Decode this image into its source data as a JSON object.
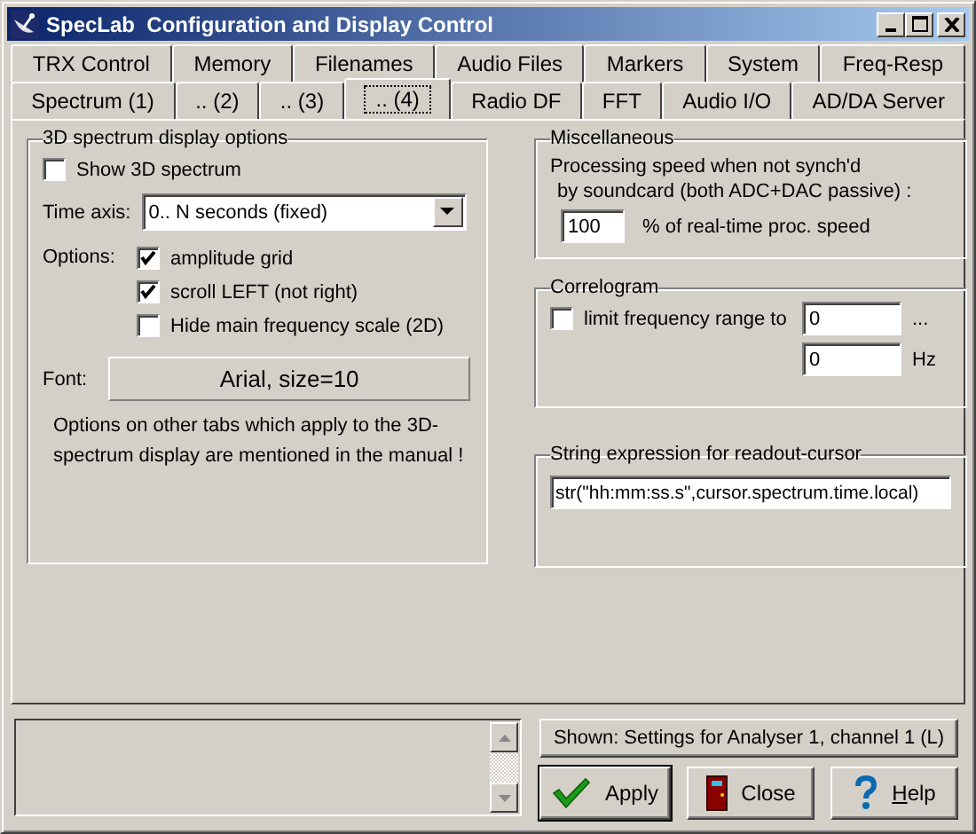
{
  "window": {
    "title": "SpecLab  Configuration and Display Control"
  },
  "tabs_row_1": [
    {
      "label": "TRX Control",
      "selected": false
    },
    {
      "label": "Memory",
      "selected": false
    },
    {
      "label": "Filenames",
      "selected": false
    },
    {
      "label": "Audio Files",
      "selected": false
    },
    {
      "label": "Markers",
      "selected": false
    },
    {
      "label": "System",
      "selected": false
    },
    {
      "label": "Freq-Resp",
      "selected": false
    }
  ],
  "tabs_row_2": [
    {
      "label": "Spectrum (1)",
      "selected": false
    },
    {
      "label": ".. (2)",
      "selected": false
    },
    {
      "label": ".. (3)",
      "selected": false
    },
    {
      "label": ".. (4)",
      "selected": true
    },
    {
      "label": "Radio DF",
      "selected": false
    },
    {
      "label": "FFT",
      "selected": false
    },
    {
      "label": "Audio I/O",
      "selected": false
    },
    {
      "label": "AD/DA Server",
      "selected": false
    }
  ],
  "spectrum_group": {
    "title": "3D spectrum display options",
    "show_3d": {
      "label": "Show 3D spectrum",
      "checked": false
    },
    "time_axis": {
      "label": "Time axis:",
      "value": "0.. N seconds (fixed)"
    },
    "options_label": "Options:",
    "options": [
      {
        "label": "amplitude grid",
        "checked": true
      },
      {
        "label": "scroll LEFT (not right)",
        "checked": true
      },
      {
        "label": "Hide main frequency scale (2D)",
        "checked": false
      }
    ],
    "font_label": "Font:",
    "font_button": "Arial, size=10",
    "note": "Options on other tabs which apply to the 3D-spectrum display are mentioned in the manual !"
  },
  "misc_group": {
    "title": "Miscellaneous",
    "text_1": "Processing speed when not synch'd",
    "text_2": "by soundcard (both ADC+DAC passive) :",
    "speed": "100",
    "speed_suffix": "% of real-time proc. speed"
  },
  "correlogram_group": {
    "title": "Correlogram",
    "limit": {
      "label": "limit frequency range to",
      "checked": false
    },
    "from": "0",
    "ellipsis": "...",
    "to": "0",
    "unit": "Hz"
  },
  "expression_group": {
    "title": "String expression for readout-cursor",
    "value": "str(\"hh:mm:ss.s\",cursor.spectrum.time.local)"
  },
  "shown_label": "Shown: Settings for Analyser 1, channel 1 (L)",
  "buttons": [
    {
      "kind": "apply",
      "label": "Apply"
    },
    {
      "kind": "close",
      "label": "Close"
    },
    {
      "kind": "help",
      "label": "Help"
    }
  ]
}
